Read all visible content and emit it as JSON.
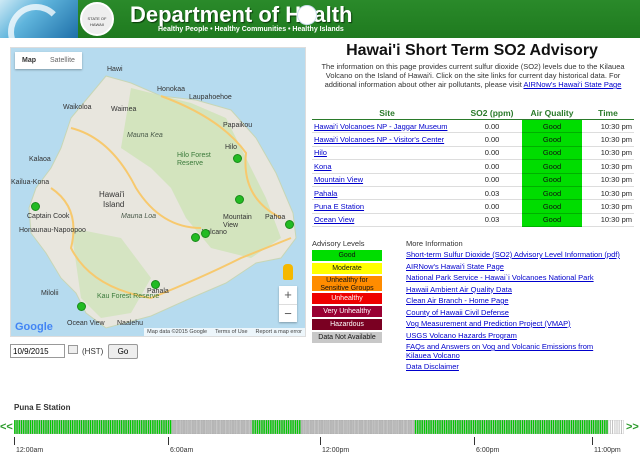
{
  "header": {
    "title": "Department of Health",
    "tagline": "Healthy People • Healthy Communities • Healthy Islands",
    "seal_text": "STATE OF HAWAII"
  },
  "map": {
    "tabs": [
      "Map",
      "Satellite"
    ],
    "labels": [
      {
        "text": "Hawi",
        "style": ""
      },
      {
        "text": "Waikoloa",
        "style": ""
      },
      {
        "text": "Waimea",
        "style": ""
      },
      {
        "text": "Honokaa",
        "style": ""
      },
      {
        "text": "Laupahoehoe",
        "style": ""
      },
      {
        "text": "Papaikou",
        "style": ""
      },
      {
        "text": "Hilo",
        "style": ""
      },
      {
        "text": "Mauna Kea",
        "style": "italic"
      },
      {
        "text": "Kalaoa",
        "style": ""
      },
      {
        "text": "Hilo Forest Reserve",
        "style": "green"
      },
      {
        "text": "Kailua-Kona",
        "style": ""
      },
      {
        "text": "Hawai'i",
        "style": ""
      },
      {
        "text": "Island",
        "style": ""
      },
      {
        "text": "Mauna Loa",
        "style": "italic"
      },
      {
        "text": "Captain Cook",
        "style": ""
      },
      {
        "text": "Mountain View",
        "style": ""
      },
      {
        "text": "Honaunau-Napoopoo",
        "style": ""
      },
      {
        "text": "Volcano",
        "style": ""
      },
      {
        "text": "Pahoa",
        "style": ""
      },
      {
        "text": "Kau Forest Reserve",
        "style": "green"
      },
      {
        "text": "Milolii",
        "style": ""
      },
      {
        "text": "Pahala",
        "style": ""
      },
      {
        "text": "Ocean View",
        "style": ""
      },
      {
        "text": "Naalehu",
        "style": ""
      }
    ],
    "footer": [
      "Map data ©2015 Google",
      "Terms of Use",
      "Report a map error"
    ],
    "google_logo": "Google",
    "zoom_in": "+",
    "zoom_out": "−"
  },
  "date_control": {
    "value": "10/9/2015",
    "tz": "(HST)",
    "go": "Go"
  },
  "advisory": {
    "title": "Hawai'i Short Term SO2 Advisory",
    "intro_text": "The information on this page provides current sulfur dioxide (SO2) levels due to the Kilauea Volcano on the Island of Hawai'i. Click on the site links for current day historical data. For additional information about other air pollutants, please visit",
    "intro_link": "AIRNow's Hawai'i State Page",
    "columns": [
      "Site",
      "SO2 (ppm)",
      "Air Quality",
      "Time"
    ],
    "rows": [
      {
        "site": "Hawai'i Volcanoes NP - Jaggar Museum",
        "so2": "0.00",
        "aq": "Good",
        "time": "10:30 pm"
      },
      {
        "site": "Hawai'i Volcanoes NP - Visitor's Center",
        "so2": "0.00",
        "aq": "Good",
        "time": "10:30 pm"
      },
      {
        "site": "Hilo",
        "so2": "0.00",
        "aq": "Good",
        "time": "10:30 pm"
      },
      {
        "site": "Kona",
        "so2": "0.00",
        "aq": "Good",
        "time": "10:30 pm"
      },
      {
        "site": "Mountain View",
        "so2": "0.00",
        "aq": "Good",
        "time": "10:30 pm"
      },
      {
        "site": "Pahala",
        "so2": "0.03",
        "aq": "Good",
        "time": "10:30 pm"
      },
      {
        "site": "Puna E Station",
        "so2": "0.00",
        "aq": "Good",
        "time": "10:30 pm"
      },
      {
        "site": "Ocean View",
        "so2": "0.03",
        "aq": "Good",
        "time": "10:30 pm"
      }
    ]
  },
  "levels": {
    "title": "Advisory Levels",
    "items": [
      {
        "label": "Good",
        "color": "#00dd00",
        "text_color": "#111"
      },
      {
        "label": "Moderate",
        "color": "#ffff00",
        "text_color": "#111"
      },
      {
        "label": "Unhealthy for Sensitive Groups",
        "color": "#ff8c00",
        "text_color": "#111"
      },
      {
        "label": "Unhealthy",
        "color": "#ee0000",
        "text_color": "#fff"
      },
      {
        "label": "Very Unhealthy",
        "color": "#990033",
        "text_color": "#fff"
      },
      {
        "label": "Hazardous",
        "color": "#7a0022",
        "text_color": "#fff"
      },
      {
        "label": "Data Not Available",
        "color": "#c8c8c8",
        "text_color": "#111"
      }
    ]
  },
  "more_info": {
    "title": "More Information",
    "links": [
      "Short-term Sulfur Dioxide (SO2) Advisory Level Information (pdf)",
      "AIRNow's Hawai'i State Page",
      "National Park Service - Hawai`i Volcanoes National Park",
      "Hawaii Ambient Air Quality Data",
      "Clean Air Branch - Home Page",
      "County of Hawaii Civil Defense",
      "Vog Measurement and Prediction Project (VMAP)",
      "USGS Volcano Hazards Program",
      "FAQs and Answers on Vog and Volcanic Emissions from Kilauea Volcano",
      "Data Disclaimer"
    ]
  },
  "timeline": {
    "station": "Puna E Station",
    "prev": "<<",
    "next": ">>",
    "ticks": [
      "12:00am",
      "6:00am",
      "12:00pm",
      "6:00pm",
      "11:00pm"
    ],
    "segments": "GGGGGGGGGGGGGGGGGGGGGGGGGGGGGGGGGGGGGGGGGGGGGGGGGGGGGGGGGGGGGGGGGGGGGGGNNNNNNNNNNNNNNNNNNNNNNNNNNNNNNNNNNNNGGGGGGGGGGGGGGGGGGGGGGNNNNNNNNNNNNNNNNNNNNNNNNNNNNNNNNNNNNNNNNNNNNNNNNNNNGGGGGGGGGGGGGGGGGGGGGGGGGGGGGGGGGGGGGGGGGGGGGGGGGGGGGGGGGGGGGGGGGGGGGGGGGGGGGGGGGGGGGGGEEEEEEE",
    "colors": {
      "G": "#00cc00",
      "N": "#bbbbbb",
      "E": "#ffffff"
    }
  }
}
